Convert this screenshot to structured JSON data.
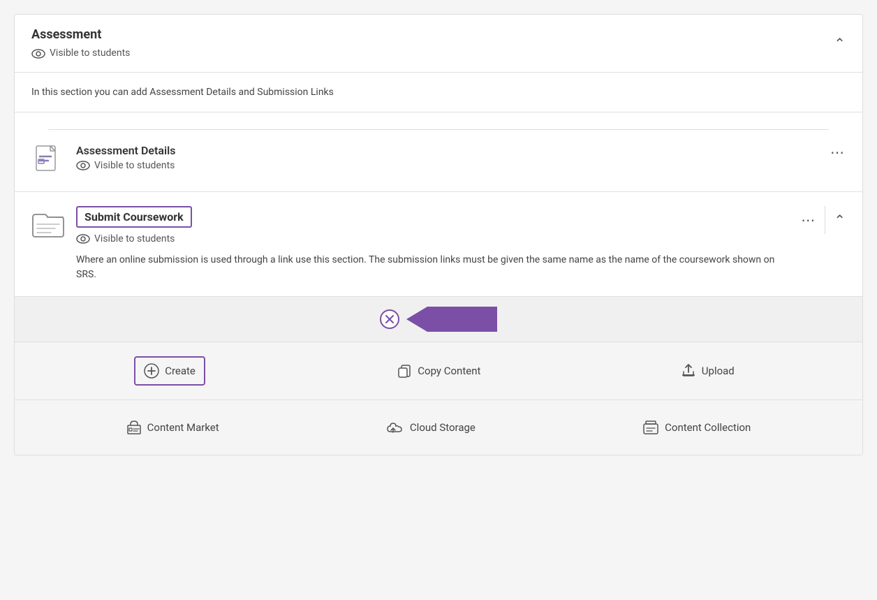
{
  "header": {
    "title": "Assessment",
    "visible_label": "Visible to students"
  },
  "description": {
    "text": "In this section you can add Assessment Details and Submission Links"
  },
  "assessment_details": {
    "title": "Assessment Details",
    "visible_label": "Visible to students"
  },
  "submit_coursework": {
    "title": "Submit Coursework",
    "visible_label": "Visible to students",
    "description": "Where an online submission is used through a link use this section. The submission links must be given the same name as the name of the coursework shown on SRS."
  },
  "toolbar": {
    "create_label": "Create",
    "copy_content_label": "Copy Content",
    "upload_label": "Upload",
    "content_market_label": "Content Market",
    "cloud_storage_label": "Cloud Storage",
    "content_collection_label": "Content Collection"
  },
  "colors": {
    "purple": "#7b4fa6",
    "text_dark": "#333",
    "text_mid": "#555",
    "border": "#e0e0e0"
  }
}
